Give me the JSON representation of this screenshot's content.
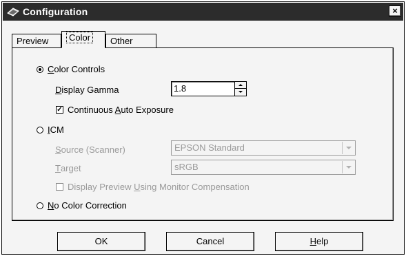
{
  "window": {
    "title": "Configuration",
    "close_label": "×"
  },
  "tabs": {
    "preview": "Preview",
    "color": "Color",
    "other": "Other"
  },
  "color_controls": {
    "label_key": "C",
    "label_rest": "olor Controls",
    "display_gamma_key": "D",
    "display_gamma_rest": "isplay Gamma",
    "gamma_value": "1.8",
    "auto_exposure_pre": "Continuous ",
    "auto_exposure_key": "A",
    "auto_exposure_rest": "uto Exposure",
    "auto_exposure_mark": "✓"
  },
  "icm": {
    "label_key": "I",
    "label_rest": "CM",
    "source_key": "S",
    "source_rest": "ource (Scanner)",
    "source_value": "EPSON Standard",
    "target_key": "T",
    "target_rest": "arget",
    "target_value": "sRGB",
    "monitor_pre": "Display Preview ",
    "monitor_key": "U",
    "monitor_rest": "sing Monitor Compensation"
  },
  "no_correction": {
    "label_key": "N",
    "label_rest": "o Color Correction"
  },
  "buttons": {
    "ok": "OK",
    "cancel": "Cancel",
    "help_key": "H",
    "help_rest": "elp"
  },
  "selected_mode": "color_controls",
  "icons": [
    "app-scanner-icon",
    "close-icon",
    "spin-up-icon",
    "spin-down-icon",
    "dropdown-arrow-icon"
  ]
}
